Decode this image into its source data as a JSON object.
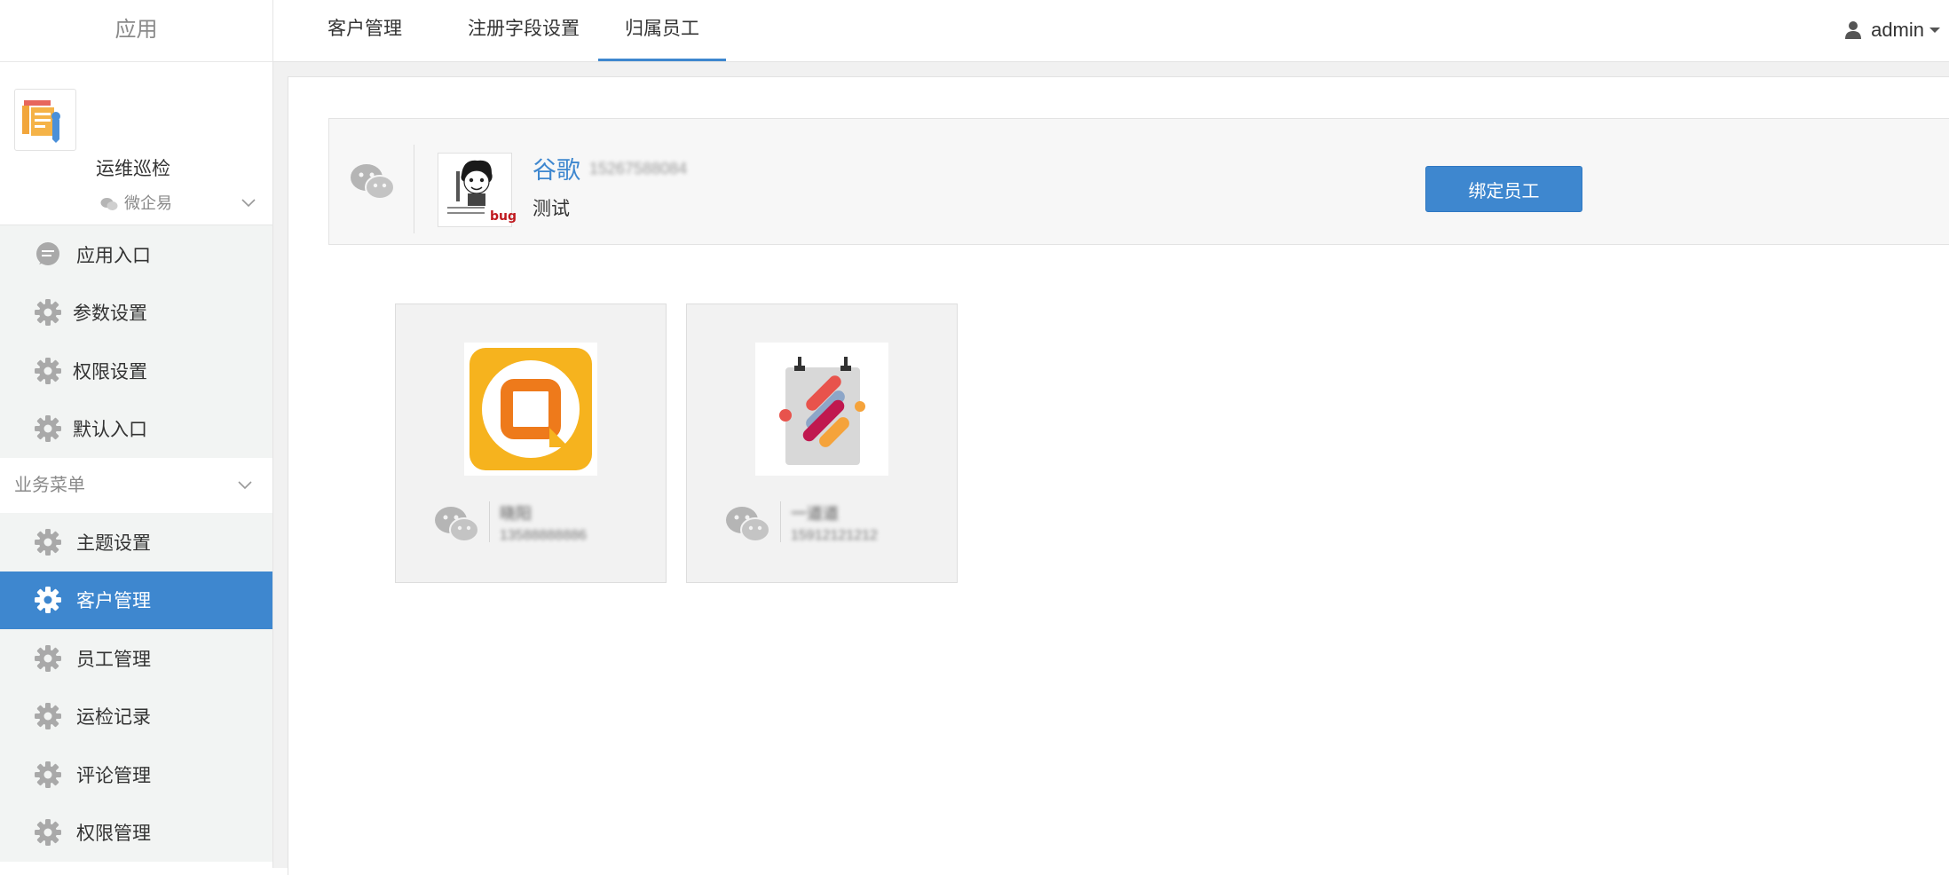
{
  "sidebar": {
    "title": "应用",
    "app_name": "运维巡检",
    "group_wechat": "微企易",
    "wechat_items": [
      {
        "label": "应用入口",
        "icon": "chat-bubble-icon"
      },
      {
        "label": "参数设置",
        "icon": "gear-icon"
      },
      {
        "label": "权限设置",
        "icon": "gear-icon"
      },
      {
        "label": "默认入口",
        "icon": "gear-icon"
      }
    ],
    "group_business": "业务菜单",
    "business_items": [
      {
        "label": "主题设置",
        "icon": "gear-icon"
      },
      {
        "label": "客户管理",
        "icon": "gear-icon",
        "active": true
      },
      {
        "label": "员工管理",
        "icon": "gear-icon"
      },
      {
        "label": "运检记录",
        "icon": "gear-icon"
      },
      {
        "label": "评论管理",
        "icon": "gear-icon"
      },
      {
        "label": "权限管理",
        "icon": "gear-icon"
      }
    ]
  },
  "topnav": {
    "tabs": [
      {
        "label": "客户管理"
      },
      {
        "label": "注册字段设置"
      },
      {
        "label": "归属员工",
        "active": true
      }
    ],
    "user": "admin"
  },
  "customer": {
    "name": "谷歌",
    "phone": "15267588084",
    "remark": "测试",
    "avatar_caption": "bug",
    "bind_button": "绑定员工"
  },
  "employees": [
    {
      "name": "晓阳",
      "phone": "13588888886"
    },
    {
      "name": "一道道",
      "phone": "15912121212"
    }
  ],
  "colors": {
    "accent": "#3e87cf",
    "sidebar_bg": "#f2f4f3",
    "main_bg": "#f1f1f1",
    "wechat_icon": "#b5b5b5"
  }
}
